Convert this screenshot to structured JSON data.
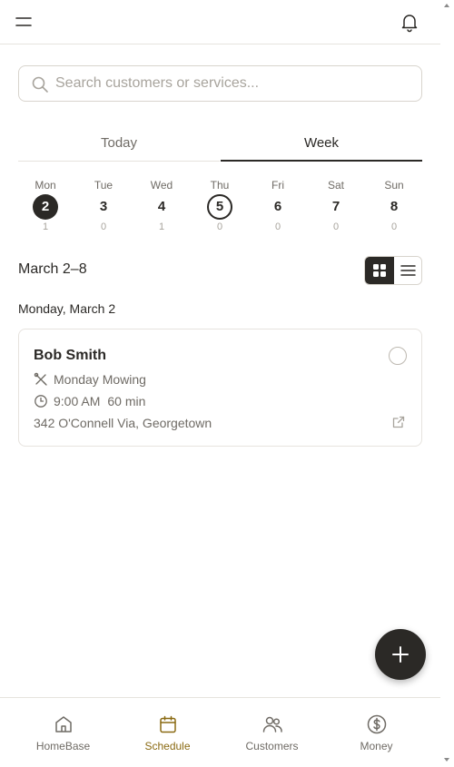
{
  "header": {
    "menu_icon": "hamburger-menu-icon",
    "notification_icon": "bell-icon"
  },
  "search": {
    "placeholder": "Search customers or services...",
    "value": "",
    "icon": "search-icon"
  },
  "tabs": [
    {
      "label": "Today",
      "active": false
    },
    {
      "label": "Week",
      "active": true
    }
  ],
  "week": {
    "days": [
      {
        "name": "Mon",
        "num": "2",
        "count": "1",
        "state": "selected"
      },
      {
        "name": "Tue",
        "num": "3",
        "count": "0",
        "state": ""
      },
      {
        "name": "Wed",
        "num": "4",
        "count": "1",
        "state": ""
      },
      {
        "name": "Thu",
        "num": "5",
        "count": "0",
        "state": "today"
      },
      {
        "name": "Fri",
        "num": "6",
        "count": "0",
        "state": ""
      },
      {
        "name": "Sat",
        "num": "7",
        "count": "0",
        "state": ""
      },
      {
        "name": "Sun",
        "num": "8",
        "count": "0",
        "state": ""
      }
    ]
  },
  "range_title": "March 2–8",
  "view_toggle": {
    "selected": "grid",
    "icons": [
      "grid-view-icon",
      "list-view-icon"
    ]
  },
  "day_heading": "Monday, March 2",
  "appointment": {
    "customer": "Bob Smith",
    "service": "Monday Mowing",
    "time": "9:00 AM",
    "duration": "60 min",
    "address": "342 O'Connell Via, Georgetown",
    "completed": false
  },
  "fab": {
    "icon": "plus-icon"
  },
  "bottom_nav": [
    {
      "label": "HomeBase",
      "icon": "home-icon",
      "active": false
    },
    {
      "label": "Schedule",
      "icon": "calendar-icon",
      "active": true
    },
    {
      "label": "Customers",
      "icon": "users-icon",
      "active": false
    },
    {
      "label": "Money",
      "icon": "dollar-circle-icon",
      "active": false
    }
  ],
  "colors": {
    "primary": "#2b2926",
    "muted_text": "#6f6b65",
    "border": "#e6e3de",
    "active_nav": "#8a6a12"
  }
}
